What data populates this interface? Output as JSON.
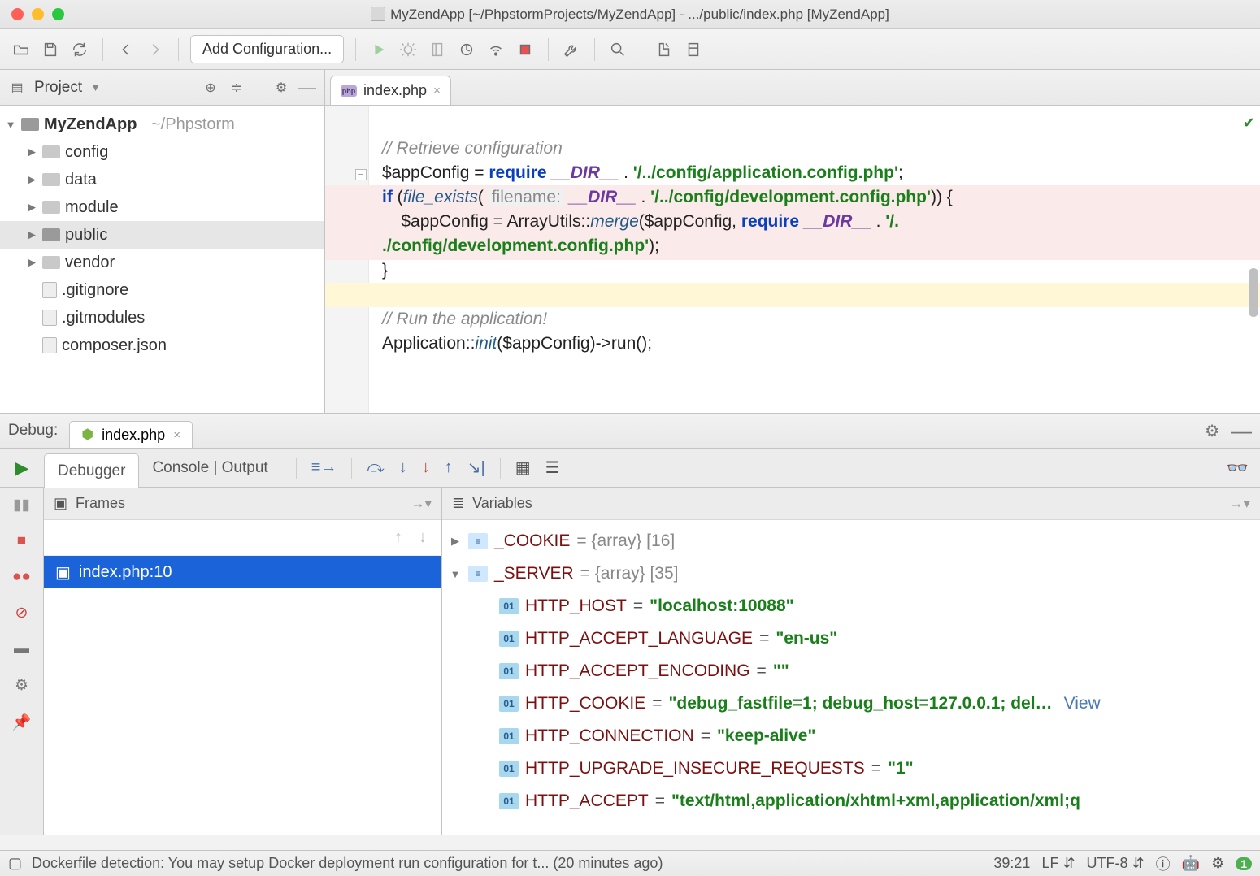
{
  "window": {
    "title": "MyZendApp [~/PhpstormProjects/MyZendApp] - .../public/index.php [MyZendApp]"
  },
  "toolbar": {
    "config_button": "Add Configuration..."
  },
  "secondary": {
    "project_label": "Project"
  },
  "editor_tabs": [
    {
      "label": "index.php"
    }
  ],
  "project_tree": {
    "root": {
      "name": "MyZendApp",
      "path": "~/Phpstorm"
    },
    "items": [
      {
        "name": "config",
        "type": "folder"
      },
      {
        "name": "data",
        "type": "folder"
      },
      {
        "name": "module",
        "type": "folder"
      },
      {
        "name": "public",
        "type": "folder",
        "selected": true
      },
      {
        "name": "vendor",
        "type": "folder"
      },
      {
        "name": ".gitignore",
        "type": "file"
      },
      {
        "name": ".gitmodules",
        "type": "file"
      },
      {
        "name": "composer.json",
        "type": "file"
      }
    ]
  },
  "code": {
    "l1": "// Retrieve configuration",
    "l2a": "$appConfig = ",
    "l2b": "require",
    "l2c": " __DIR__",
    "l2d": " . ",
    "l2e": "'/../config/application.config.php'",
    "l2f": ";",
    "l3a": "if",
    "l3b": " (",
    "l3c": "file_exists",
    "l3d": "( ",
    "l3hint": "filename:",
    "l3e": " __DIR__",
    "l3f": " . ",
    "l3g": "'/../config/development.config.php'",
    "l3h": ")) {",
    "l4a": "    $appConfig = ArrayUtils::",
    "l4b": "merge",
    "l4c": "($appConfig, ",
    "l4d": "require",
    "l4e": " __DIR__",
    "l4f": " . ",
    "l4g": "'/.",
    "l5a": "./config/development.config.php'",
    "l5b": ");",
    "l6": "}",
    "l8": "// Run the application!",
    "l9a": "Application::",
    "l9b": "init",
    "l9c": "($appConfig)->run();"
  },
  "debug": {
    "label": "Debug:",
    "tab": "index.php",
    "tabs": {
      "debugger": "Debugger",
      "console": "Console | Output"
    },
    "frames_title": "Frames",
    "vars_title": "Variables",
    "frame": "index.php:10",
    "variables": {
      "cookie": {
        "name": "_COOKIE",
        "extra": " = {array} [16]"
      },
      "server": {
        "name": "_SERVER",
        "extra": " = {array} [35]"
      },
      "items": [
        {
          "k": "HTTP_HOST",
          "v": "\"localhost:10088\""
        },
        {
          "k": "HTTP_ACCEPT_LANGUAGE",
          "v": "\"en-us\""
        },
        {
          "k": "HTTP_ACCEPT_ENCODING",
          "v": "\"\""
        },
        {
          "k": "HTTP_COOKIE",
          "v": "\"debug_fastfile=1; debug_host=127.0.0.1; del…",
          "view": "View"
        },
        {
          "k": "HTTP_CONNECTION",
          "v": "\"keep-alive\""
        },
        {
          "k": "HTTP_UPGRADE_INSECURE_REQUESTS",
          "v": "\"1\""
        },
        {
          "k": "HTTP_ACCEPT",
          "v": "\"text/html,application/xhtml+xml,application/xml;q"
        }
      ]
    }
  },
  "status": {
    "msg": "Dockerfile detection: You may setup Docker deployment run configuration for t... (20 minutes ago)",
    "pos": "39:21",
    "le": "LF",
    "enc": "UTF-8",
    "badge": "1"
  }
}
